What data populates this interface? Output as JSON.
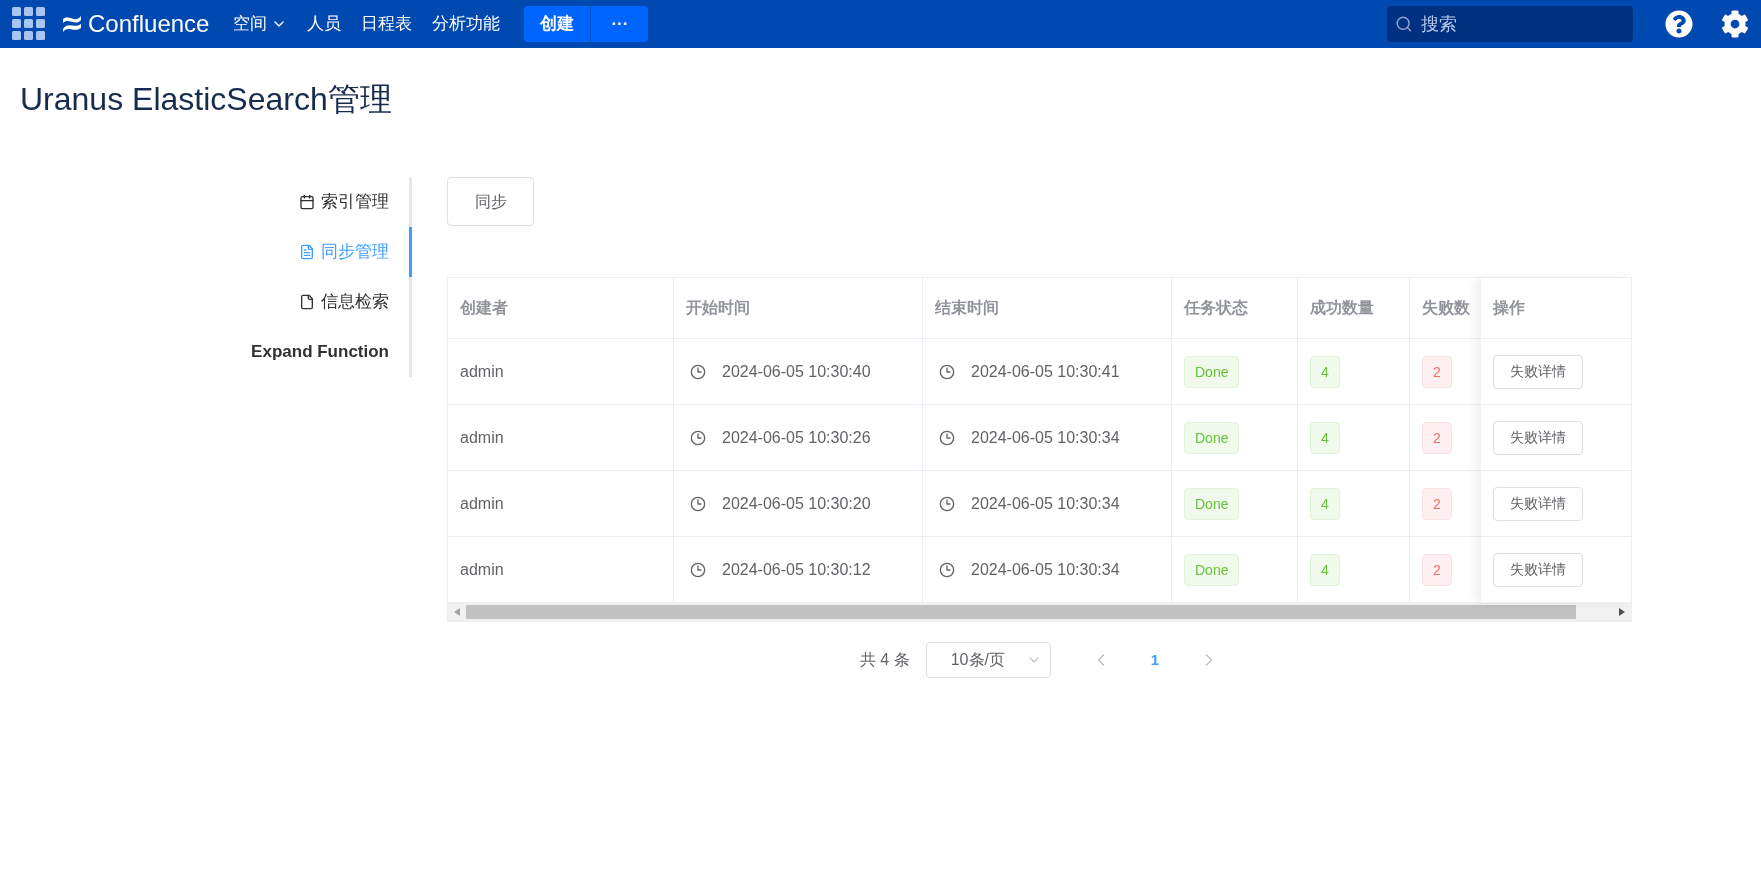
{
  "topbar": {
    "logo": "Confluence",
    "nav": [
      {
        "label": "空间",
        "dropdown": true
      },
      {
        "label": "人员",
        "dropdown": false
      },
      {
        "label": "日程表",
        "dropdown": false
      },
      {
        "label": "分析功能",
        "dropdown": false
      }
    ],
    "create": "创建",
    "more": "···",
    "search": {
      "placeholder": "搜索"
    }
  },
  "page_title": "Uranus ElasticSearch管理",
  "sidebar": {
    "items": [
      {
        "label": "索引管理",
        "selected": false
      },
      {
        "label": "同步管理",
        "selected": true
      },
      {
        "label": "信息检索",
        "selected": false
      },
      {
        "label": "Expand Function",
        "selected": false
      }
    ]
  },
  "sync_button": "同步",
  "table": {
    "columns": [
      "创建者",
      "开始时间",
      "结束时间",
      "任务状态",
      "成功数量",
      "失败数",
      "操作"
    ],
    "rows": [
      {
        "creator": "admin",
        "start": "2024-06-05 10:30:40",
        "end": "2024-06-05 10:30:41",
        "status": "Done",
        "success": "4",
        "failed": "2",
        "action": "失败详情"
      },
      {
        "creator": "admin",
        "start": "2024-06-05 10:30:26",
        "end": "2024-06-05 10:30:34",
        "status": "Done",
        "success": "4",
        "failed": "2",
        "action": "失败详情"
      },
      {
        "creator": "admin",
        "start": "2024-06-05 10:30:20",
        "end": "2024-06-05 10:30:34",
        "status": "Done",
        "success": "4",
        "failed": "2",
        "action": "失败详情"
      },
      {
        "creator": "admin",
        "start": "2024-06-05 10:30:12",
        "end": "2024-06-05 10:30:34",
        "status": "Done",
        "success": "4",
        "failed": "2",
        "action": "失败详情"
      }
    ]
  },
  "pagination": {
    "total": "共 4 条",
    "page_size": "10条/页",
    "pages": [
      {
        "label": "1",
        "selected": true
      }
    ]
  }
}
